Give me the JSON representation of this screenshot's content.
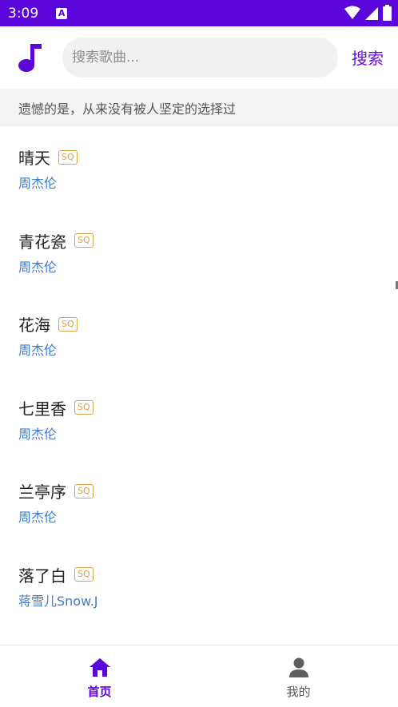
{
  "status_bar": {
    "time": "3:09",
    "notification_letter": "A",
    "icons": [
      "wifi-icon",
      "signal-icon",
      "battery-icon"
    ]
  },
  "header": {
    "logo_icon": "music-note-icon",
    "search_placeholder": "搜索歌曲...",
    "search_button": "搜索"
  },
  "banner": {
    "text": "遗憾的是，从来没有被人坚定的选择过"
  },
  "songs": [
    {
      "title": "晴天",
      "badge": "SQ",
      "artist": "周杰伦"
    },
    {
      "title": "青花瓷",
      "badge": "SQ",
      "artist": "周杰伦"
    },
    {
      "title": "花海",
      "badge": "SQ",
      "artist": "周杰伦"
    },
    {
      "title": "七里香",
      "badge": "SQ",
      "artist": "周杰伦"
    },
    {
      "title": "兰亭序",
      "badge": "SQ",
      "artist": "周杰伦"
    },
    {
      "title": "落了白",
      "badge": "SQ",
      "artist": "蒋雪儿Snow.J"
    }
  ],
  "bottom_nav": [
    {
      "label": "首页",
      "icon": "home-icon",
      "active": true
    },
    {
      "label": "我的",
      "icon": "person-icon",
      "active": false
    }
  ],
  "colors": {
    "accent": "#5a05d9",
    "artist": "#3a7bd5",
    "badge": "#d9a34a"
  }
}
